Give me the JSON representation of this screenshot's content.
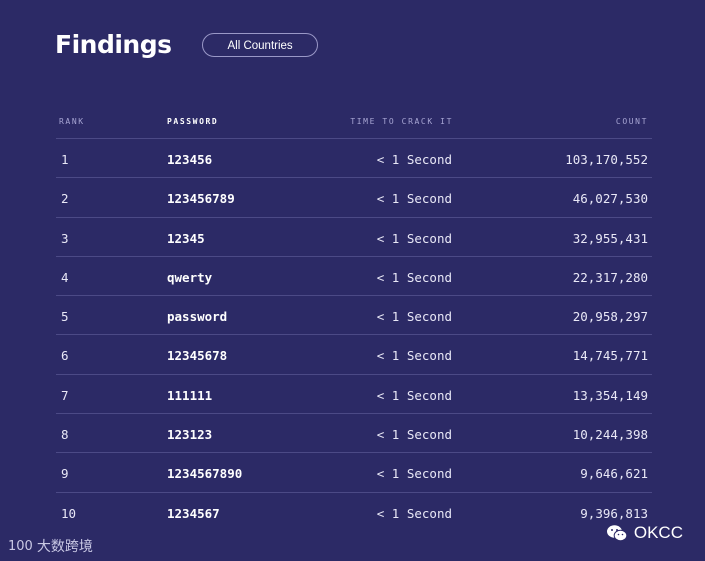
{
  "header": {
    "title": "Findings",
    "filter_label": "All Countries"
  },
  "table": {
    "columns": {
      "rank": "RANK",
      "password": "PASSWORD",
      "time": "TIME TO CRACK IT",
      "count": "COUNT"
    },
    "rows": [
      {
        "rank": "1",
        "password": "123456",
        "time": "< 1 Second",
        "count": "103,170,552"
      },
      {
        "rank": "2",
        "password": "123456789",
        "time": "< 1 Second",
        "count": "46,027,530"
      },
      {
        "rank": "3",
        "password": "12345",
        "time": "< 1 Second",
        "count": "32,955,431"
      },
      {
        "rank": "4",
        "password": "qwerty",
        "time": "< 1 Second",
        "count": "22,317,280"
      },
      {
        "rank": "5",
        "password": "password",
        "time": "< 1 Second",
        "count": "20,958,297"
      },
      {
        "rank": "6",
        "password": "12345678",
        "time": "< 1 Second",
        "count": "14,745,771"
      },
      {
        "rank": "7",
        "password": "111111",
        "time": "< 1 Second",
        "count": "13,354,149"
      },
      {
        "rank": "8",
        "password": "123123",
        "time": "< 1 Second",
        "count": "10,244,398"
      },
      {
        "rank": "9",
        "password": "1234567890",
        "time": "< 1 Second",
        "count": "9,646,621"
      },
      {
        "rank": "10",
        "password": "1234567",
        "time": "< 1 Second",
        "count": "9,396,813"
      }
    ]
  },
  "watermarks": {
    "left_logo": "100",
    "left_text": "大数跨境",
    "right_text": "OKCC",
    "right_icon": "wechat-icon"
  },
  "colors": {
    "background": "#2c2a66",
    "divider": "#4c4a86",
    "header_text": "#a7a5d3"
  }
}
